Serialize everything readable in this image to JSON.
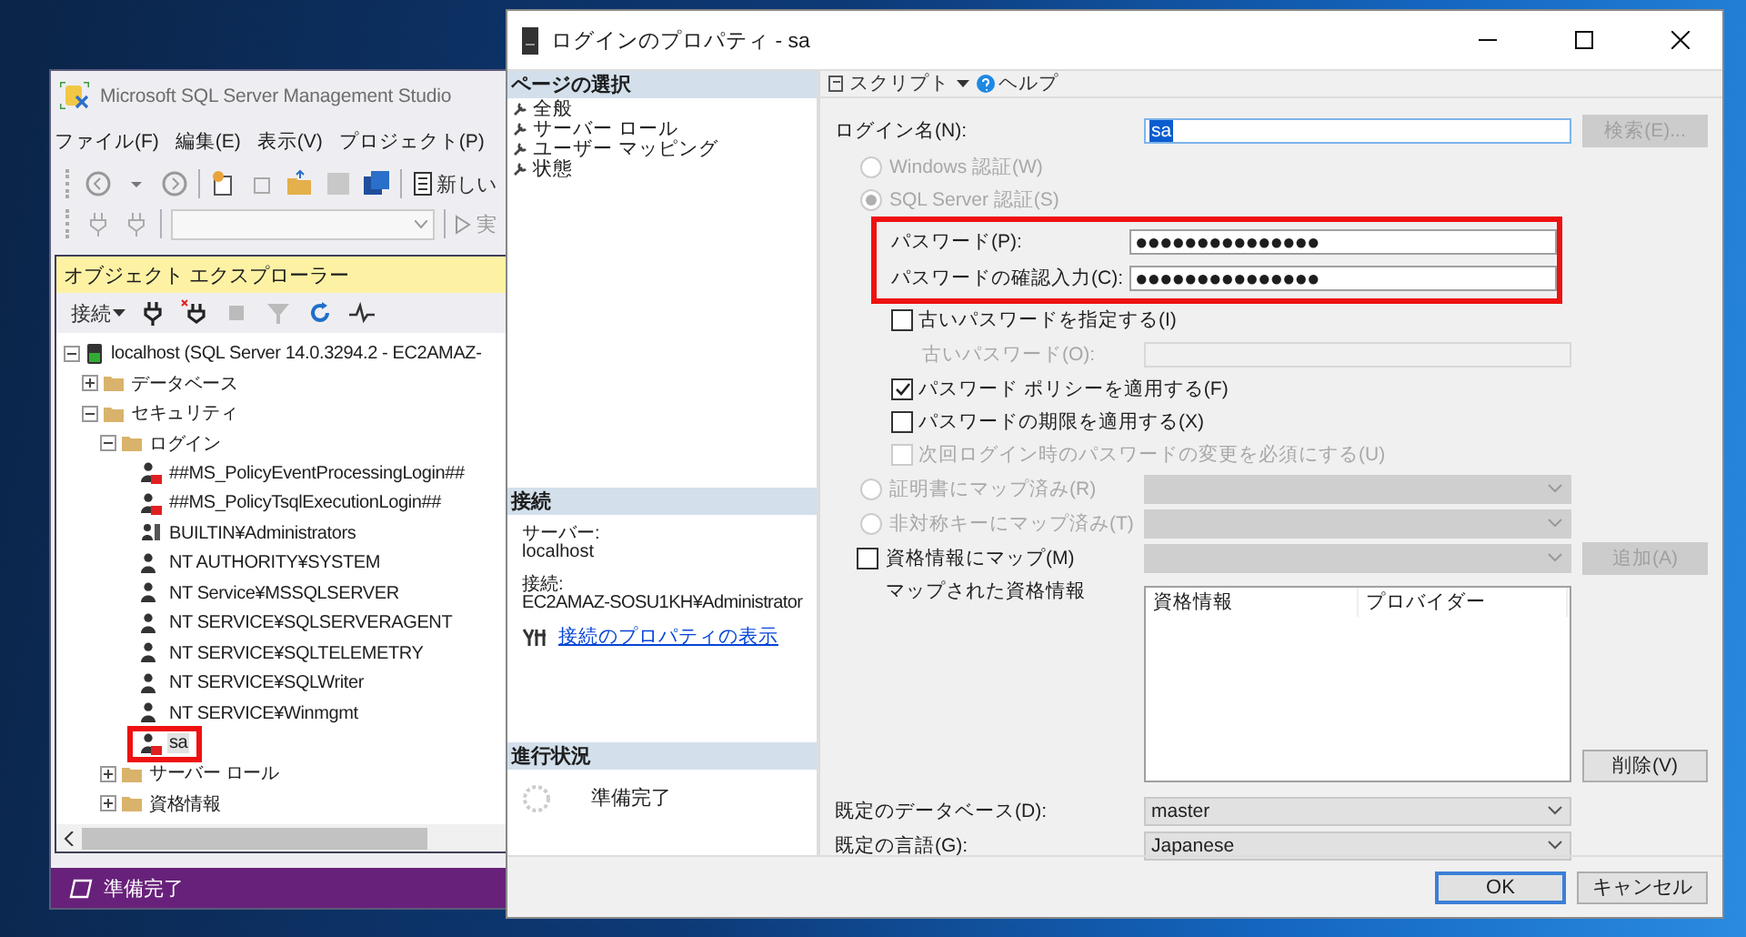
{
  "ssms": {
    "title": "Microsoft SQL Server Management Studio",
    "menu": [
      {
        "label": "ファイル(F)"
      },
      {
        "label": "編集(E)"
      },
      {
        "label": "表示(V)"
      },
      {
        "label": "プロジェクト(P)"
      }
    ],
    "toolbar_new_query": "新しい",
    "toolbar_execute": "実",
    "explorer": {
      "title": "オブジェクト エクスプローラー",
      "connect": "接続",
      "tree": [
        {
          "label": "localhost (SQL Server 14.0.3294.2 - EC2AMAZ-",
          "kind": "server",
          "expanded": true,
          "selected": false,
          "highlighted": false,
          "children": [
            {
              "label": "データベース",
              "kind": "folder",
              "expanded": false,
              "selected": false,
              "highlighted": false
            },
            {
              "label": "セキュリティ",
              "kind": "folder",
              "expanded": true,
              "selected": false,
              "highlighted": false,
              "children": [
                {
                  "label": "ログイン",
                  "kind": "folder",
                  "expanded": true,
                  "selected": false,
                  "highlighted": false,
                  "children": [
                    {
                      "label": "##MS_PolicyEventProcessingLogin##",
                      "kind": "login",
                      "disabled": true,
                      "selected": false,
                      "highlighted": false
                    },
                    {
                      "label": "##MS_PolicyTsqlExecutionLogin##",
                      "kind": "login",
                      "disabled": true,
                      "selected": false,
                      "highlighted": false
                    },
                    {
                      "label": "BUILTIN¥Administrators",
                      "kind": "group",
                      "disabled": false,
                      "selected": false,
                      "highlighted": false
                    },
                    {
                      "label": "NT AUTHORITY¥SYSTEM",
                      "kind": "login",
                      "disabled": false,
                      "selected": false,
                      "highlighted": false
                    },
                    {
                      "label": "NT Service¥MSSQLSERVER",
                      "kind": "login",
                      "disabled": false,
                      "selected": false,
                      "highlighted": false
                    },
                    {
                      "label": "NT SERVICE¥SQLSERVERAGENT",
                      "kind": "login",
                      "disabled": false,
                      "selected": false,
                      "highlighted": false
                    },
                    {
                      "label": "NT SERVICE¥SQLTELEMETRY",
                      "kind": "login",
                      "disabled": false,
                      "selected": false,
                      "highlighted": false
                    },
                    {
                      "label": "NT SERVICE¥SQLWriter",
                      "kind": "login",
                      "disabled": false,
                      "selected": false,
                      "highlighted": false
                    },
                    {
                      "label": "NT SERVICE¥Winmgmt",
                      "kind": "login",
                      "disabled": false,
                      "selected": false,
                      "highlighted": false
                    },
                    {
                      "label": "sa",
                      "kind": "login",
                      "disabled": true,
                      "selected": true,
                      "highlighted": true
                    }
                  ]
                },
                {
                  "label": "サーバー ロール",
                  "kind": "folder",
                  "expanded": false,
                  "selected": false,
                  "highlighted": false
                },
                {
                  "label": "資格情報",
                  "kind": "folder",
                  "expanded": false,
                  "selected": false,
                  "highlighted": false
                }
              ]
            }
          ]
        }
      ]
    },
    "status": "準備完了"
  },
  "dialog": {
    "title": "ログインのプロパティ - sa",
    "pages": {
      "header": "ページの選択",
      "items": [
        {
          "label": "全般"
        },
        {
          "label": "サーバー ロール"
        },
        {
          "label": "ユーザー マッピング"
        },
        {
          "label": "状態"
        }
      ]
    },
    "connection": {
      "header": "接続",
      "server_label": "サーバー:",
      "server": "localhost",
      "connection_label": "接続:",
      "connection": "EC2AMAZ-SOSU1KH¥Administrator",
      "link": "接続のプロパティの表示"
    },
    "progress": {
      "header": "進行状況",
      "status": "準備完了"
    },
    "toolbar": {
      "script": "スクリプト",
      "help": "ヘルプ"
    },
    "login_name": {
      "label": "ログイン名(N):",
      "value": "sa",
      "button": {
        "label": "検索(E)...",
        "disabled": true
      }
    },
    "auth": [
      {
        "label": "Windows 認証(W)",
        "selected": false,
        "disabled": true
      },
      {
        "label": "SQL Server 認証(S)",
        "selected": true,
        "disabled": true
      }
    ],
    "passwords": {
      "highlighted": true,
      "fields": [
        {
          "label": "パスワード(P):",
          "value": "●●●●●●●●●●●●●●●"
        },
        {
          "label": "パスワードの確認入力(C):",
          "value": "●●●●●●●●●●●●●●●"
        }
      ]
    },
    "options": [
      {
        "kind": "checkbox",
        "label": "古いパスワードを指定する(I)",
        "checked": false,
        "disabled": false
      },
      {
        "kind": "field",
        "label": "古いパスワード(O):",
        "disabled": true
      },
      {
        "kind": "checkbox",
        "label": "パスワード ポリシーを適用する(F)",
        "checked": true,
        "disabled": false
      },
      {
        "kind": "checkbox",
        "label": "パスワードの期限を適用する(X)",
        "checked": false,
        "disabled": false
      },
      {
        "kind": "checkbox",
        "label": "次回ログイン時のパスワードの変更を必須にする(U)",
        "checked": false,
        "disabled": true
      }
    ],
    "mappings": [
      {
        "kind": "radio",
        "label": "証明書にマップ済み(R)",
        "selected": false,
        "disabled": true
      },
      {
        "kind": "radio",
        "label": "非対称キーにマップ済み(T)",
        "selected": false,
        "disabled": true
      },
      {
        "kind": "checkbox",
        "label": "資格情報にマップ(M)",
        "checked": false,
        "disabled": false,
        "button": {
          "label": "追加(A)",
          "disabled": true
        }
      }
    ],
    "mapped_credentials": {
      "label": "マップされた資格情報",
      "columns": [
        "資格情報",
        "プロバイダー"
      ],
      "button": {
        "label": "削除(V)",
        "disabled": false
      }
    },
    "defaults": [
      {
        "label": "既定のデータベース(D):",
        "value": "master"
      },
      {
        "label": "既定の言語(G):",
        "value": "Japanese"
      }
    ],
    "buttons": [
      {
        "label": "OK",
        "default": true
      },
      {
        "label": "キャンセル",
        "default": false
      }
    ]
  }
}
